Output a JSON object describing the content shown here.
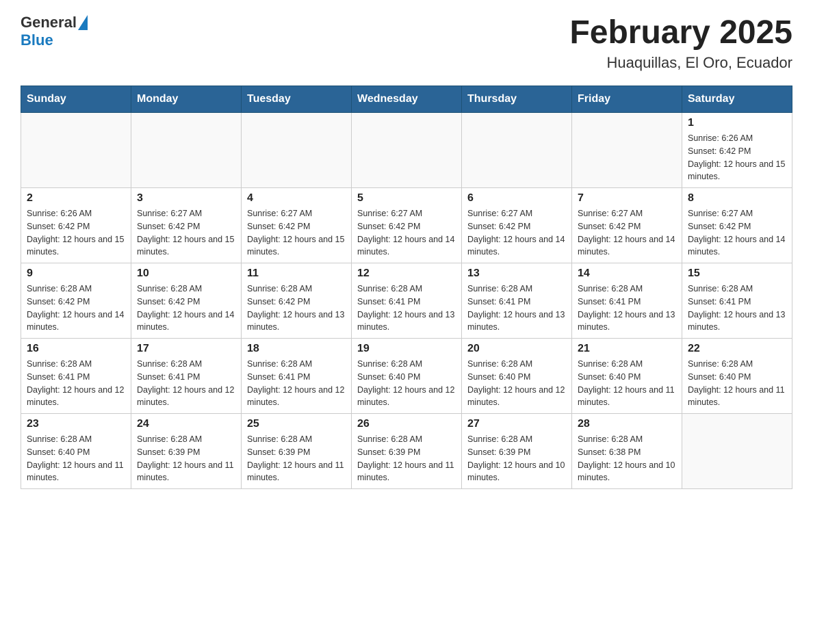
{
  "header": {
    "logo_general": "General",
    "logo_blue": "Blue",
    "month_title": "February 2025",
    "location": "Huaquillas, El Oro, Ecuador"
  },
  "weekdays": [
    "Sunday",
    "Monday",
    "Tuesday",
    "Wednesday",
    "Thursday",
    "Friday",
    "Saturday"
  ],
  "weeks": [
    [
      {
        "day": "",
        "info": ""
      },
      {
        "day": "",
        "info": ""
      },
      {
        "day": "",
        "info": ""
      },
      {
        "day": "",
        "info": ""
      },
      {
        "day": "",
        "info": ""
      },
      {
        "day": "",
        "info": ""
      },
      {
        "day": "1",
        "info": "Sunrise: 6:26 AM\nSunset: 6:42 PM\nDaylight: 12 hours and 15 minutes."
      }
    ],
    [
      {
        "day": "2",
        "info": "Sunrise: 6:26 AM\nSunset: 6:42 PM\nDaylight: 12 hours and 15 minutes."
      },
      {
        "day": "3",
        "info": "Sunrise: 6:27 AM\nSunset: 6:42 PM\nDaylight: 12 hours and 15 minutes."
      },
      {
        "day": "4",
        "info": "Sunrise: 6:27 AM\nSunset: 6:42 PM\nDaylight: 12 hours and 15 minutes."
      },
      {
        "day": "5",
        "info": "Sunrise: 6:27 AM\nSunset: 6:42 PM\nDaylight: 12 hours and 14 minutes."
      },
      {
        "day": "6",
        "info": "Sunrise: 6:27 AM\nSunset: 6:42 PM\nDaylight: 12 hours and 14 minutes."
      },
      {
        "day": "7",
        "info": "Sunrise: 6:27 AM\nSunset: 6:42 PM\nDaylight: 12 hours and 14 minutes."
      },
      {
        "day": "8",
        "info": "Sunrise: 6:27 AM\nSunset: 6:42 PM\nDaylight: 12 hours and 14 minutes."
      }
    ],
    [
      {
        "day": "9",
        "info": "Sunrise: 6:28 AM\nSunset: 6:42 PM\nDaylight: 12 hours and 14 minutes."
      },
      {
        "day": "10",
        "info": "Sunrise: 6:28 AM\nSunset: 6:42 PM\nDaylight: 12 hours and 14 minutes."
      },
      {
        "day": "11",
        "info": "Sunrise: 6:28 AM\nSunset: 6:42 PM\nDaylight: 12 hours and 13 minutes."
      },
      {
        "day": "12",
        "info": "Sunrise: 6:28 AM\nSunset: 6:41 PM\nDaylight: 12 hours and 13 minutes."
      },
      {
        "day": "13",
        "info": "Sunrise: 6:28 AM\nSunset: 6:41 PM\nDaylight: 12 hours and 13 minutes."
      },
      {
        "day": "14",
        "info": "Sunrise: 6:28 AM\nSunset: 6:41 PM\nDaylight: 12 hours and 13 minutes."
      },
      {
        "day": "15",
        "info": "Sunrise: 6:28 AM\nSunset: 6:41 PM\nDaylight: 12 hours and 13 minutes."
      }
    ],
    [
      {
        "day": "16",
        "info": "Sunrise: 6:28 AM\nSunset: 6:41 PM\nDaylight: 12 hours and 12 minutes."
      },
      {
        "day": "17",
        "info": "Sunrise: 6:28 AM\nSunset: 6:41 PM\nDaylight: 12 hours and 12 minutes."
      },
      {
        "day": "18",
        "info": "Sunrise: 6:28 AM\nSunset: 6:41 PM\nDaylight: 12 hours and 12 minutes."
      },
      {
        "day": "19",
        "info": "Sunrise: 6:28 AM\nSunset: 6:40 PM\nDaylight: 12 hours and 12 minutes."
      },
      {
        "day": "20",
        "info": "Sunrise: 6:28 AM\nSunset: 6:40 PM\nDaylight: 12 hours and 12 minutes."
      },
      {
        "day": "21",
        "info": "Sunrise: 6:28 AM\nSunset: 6:40 PM\nDaylight: 12 hours and 11 minutes."
      },
      {
        "day": "22",
        "info": "Sunrise: 6:28 AM\nSunset: 6:40 PM\nDaylight: 12 hours and 11 minutes."
      }
    ],
    [
      {
        "day": "23",
        "info": "Sunrise: 6:28 AM\nSunset: 6:40 PM\nDaylight: 12 hours and 11 minutes."
      },
      {
        "day": "24",
        "info": "Sunrise: 6:28 AM\nSunset: 6:39 PM\nDaylight: 12 hours and 11 minutes."
      },
      {
        "day": "25",
        "info": "Sunrise: 6:28 AM\nSunset: 6:39 PM\nDaylight: 12 hours and 11 minutes."
      },
      {
        "day": "26",
        "info": "Sunrise: 6:28 AM\nSunset: 6:39 PM\nDaylight: 12 hours and 11 minutes."
      },
      {
        "day": "27",
        "info": "Sunrise: 6:28 AM\nSunset: 6:39 PM\nDaylight: 12 hours and 10 minutes."
      },
      {
        "day": "28",
        "info": "Sunrise: 6:28 AM\nSunset: 6:38 PM\nDaylight: 12 hours and 10 minutes."
      },
      {
        "day": "",
        "info": ""
      }
    ]
  ]
}
